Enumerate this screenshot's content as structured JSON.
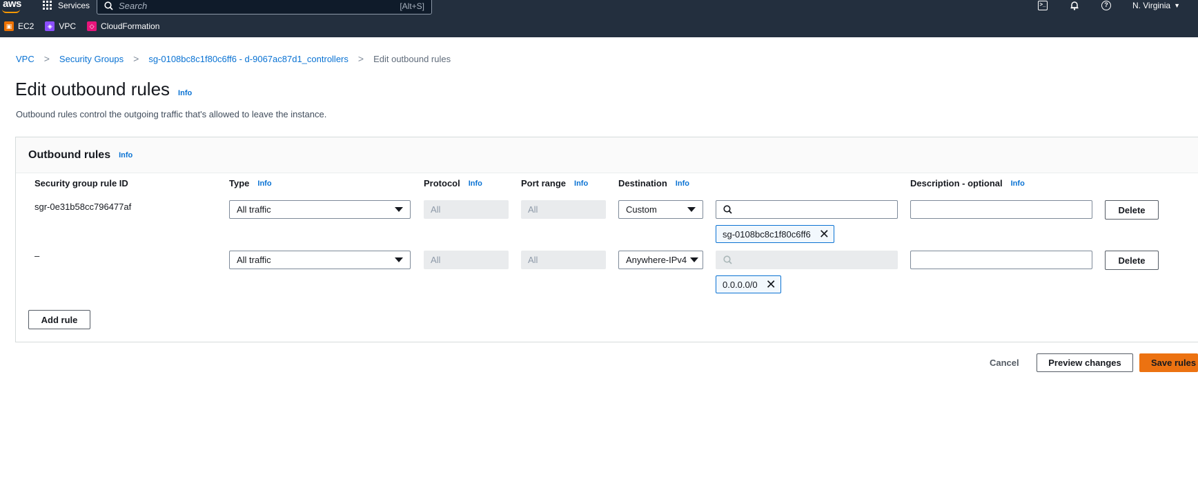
{
  "topnav": {
    "logo": "aws",
    "services_label": "Services",
    "search_placeholder": "Search",
    "search_shortcut": "[Alt+S]",
    "region": "N. Virginia",
    "icons": [
      "cloudshell-icon",
      "bell-icon",
      "help-icon"
    ]
  },
  "favorites": [
    {
      "label": "EC2",
      "color": "#ed7100"
    },
    {
      "label": "VPC",
      "color": "#8c4fff"
    },
    {
      "label": "CloudFormation",
      "color": "#e7157b"
    }
  ],
  "breadcrumb": {
    "items": [
      "VPC",
      "Security Groups",
      "sg-0108bc8c1f80c6ff6 - d-9067ac87d1_controllers"
    ],
    "current": "Edit outbound rules"
  },
  "page": {
    "title": "Edit outbound rules",
    "info": "Info",
    "description": "Outbound rules control the outgoing traffic that's allowed to leave the instance."
  },
  "panel": {
    "title": "Outbound rules",
    "info": "Info",
    "columns": {
      "rule_id": "Security group rule ID",
      "type": "Type",
      "protocol": "Protocol",
      "port_range": "Port range",
      "destination": "Destination",
      "description": "Description - optional",
      "info": "Info"
    },
    "rows": [
      {
        "rule_id": "sgr-0e31b58cc796477af",
        "type": "All traffic",
        "protocol": "All",
        "port_range": "All",
        "destination": "Custom",
        "token": "sg-0108bc8c1f80c6ff6",
        "delete": "Delete"
      },
      {
        "rule_id": "–",
        "type": "All traffic",
        "protocol": "All",
        "port_range": "All",
        "destination": "Anywhere-IPv4",
        "token": "0.0.0.0/0",
        "delete": "Delete"
      }
    ],
    "add_rule": "Add rule"
  },
  "footer": {
    "cancel": "Cancel",
    "preview": "Preview changes",
    "save": "Save rules"
  },
  "colors": {
    "nav_bg": "#232f3e",
    "link": "#0972d3",
    "primary": "#ec7211"
  }
}
